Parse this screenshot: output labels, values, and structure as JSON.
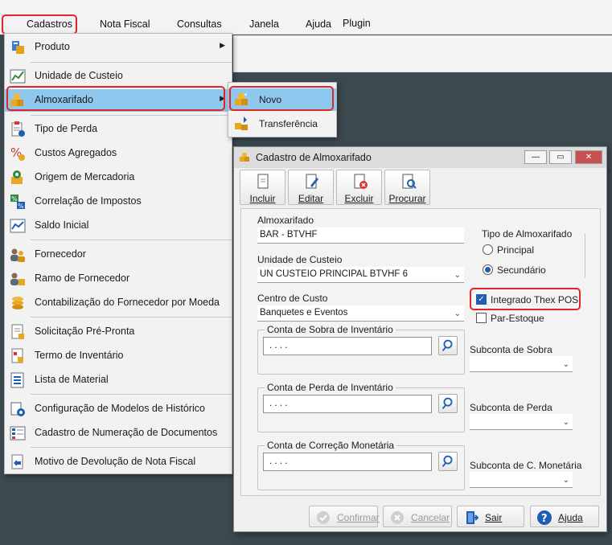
{
  "menubar": {
    "items": [
      {
        "label": "Cadastros"
      },
      {
        "label": "Nota Fiscal"
      },
      {
        "label": "Consultas"
      },
      {
        "label": "Janela"
      },
      {
        "label": "Ajuda"
      },
      {
        "label": "Plugin"
      }
    ]
  },
  "dropdown": {
    "items": [
      {
        "label": "Produto",
        "icon": "product-icon",
        "submenu": true
      },
      {
        "label": "Unidade de Custeio",
        "icon": "chart-icon"
      },
      {
        "label": "Almoxarifado",
        "icon": "boxes-icon",
        "submenu": true,
        "selected": true
      },
      {
        "label": "Tipo de Perda",
        "icon": "clipboard-icon"
      },
      {
        "label": "Custos Agregados",
        "icon": "percent-icon"
      },
      {
        "label": "Origem de Mercadoria",
        "icon": "map-pin-icon"
      },
      {
        "label": "Correlação de Impostos",
        "icon": "tax-percent-icon"
      },
      {
        "label": "Saldo Inicial",
        "icon": "chart-line-icon"
      },
      {
        "label": "Fornecedor",
        "icon": "people-icon"
      },
      {
        "label": "Ramo de Fornecedor",
        "icon": "people-branch-icon"
      },
      {
        "label": "Contabilização do Fornecedor por Moeda",
        "icon": "coins-icon"
      },
      {
        "label": "Solicitação Pré-Pronta",
        "icon": "document-icon"
      },
      {
        "label": "Termo de Inventário",
        "icon": "inventory-icon"
      },
      {
        "label": "Lista de Material",
        "icon": "list-icon"
      },
      {
        "label": "Configuração de Modelos de Histórico",
        "icon": "config-icon"
      },
      {
        "label": "Cadastro de Numeração de Documentos",
        "icon": "numbering-icon"
      },
      {
        "label": "Motivo de Devolução de Nota Fiscal",
        "icon": "return-icon"
      }
    ]
  },
  "submenu": {
    "items": [
      {
        "label": "Novo",
        "selected": true
      },
      {
        "label": "Transferência"
      }
    ]
  },
  "dialog": {
    "title": "Cadastro de Almoxarifado",
    "titlebar_buttons": {
      "minimize": "—",
      "restore": "▭",
      "close": "✕"
    },
    "toolbar": {
      "incluir": "Incluir",
      "editar": "Editar",
      "excluir": "Excluir",
      "procurar": "Procurar"
    },
    "almoxarifado_label": "Almoxarifado",
    "almoxarifado_value": "BAR - BTVHF",
    "unidade_label": "Unidade de Custeio",
    "unidade_value": "UN CUSTEIO PRINCIPAL BTVHF 6",
    "centro_label": "Centro de Custo",
    "centro_value": "Banquetes e Eventos",
    "tipo_label": "Tipo de Almoxarifado",
    "tipo_principal": "Principal",
    "tipo_secundario": "Secundário",
    "tipo_selected": "Secundário",
    "integrado_label": "Integrado Thex POS",
    "integrado_checked": true,
    "par_estoque_label": "Par-Estoque",
    "par_estoque_checked": false,
    "sobra_group": "Conta de Sobra de Inventário",
    "sobra_value": ". . . .",
    "subconta_sobra_label": "Subconta de Sobra",
    "perda_group": "Conta de Perda de Inventário",
    "perda_value": ". . . .",
    "subconta_perda_label": "Subconta de Perda",
    "correcao_group": "Conta de Correção Monetária",
    "correcao_value": ". . . .",
    "subconta_correcao_label": "Subconta de C. Monetária",
    "footer": {
      "confirmar": "Confirmar",
      "cancelar": "Cancelar",
      "sair": "Sair",
      "ajuda": "Ajuda"
    }
  },
  "colors": {
    "highlight_red": "#e0242a",
    "menu_selection": "#8ec8ef",
    "accent_blue": "#1f5fb3"
  }
}
